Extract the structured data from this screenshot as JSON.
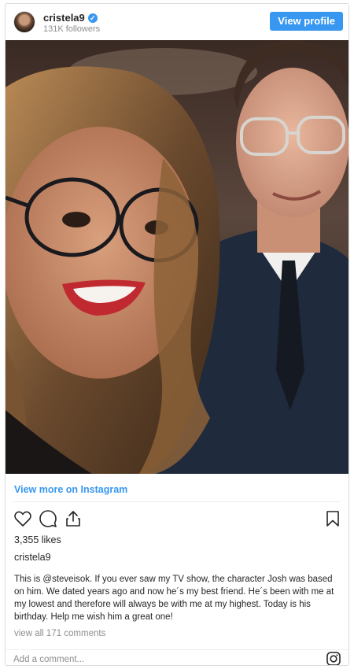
{
  "post": {
    "username": "cristela9",
    "followers": "131K followers",
    "view_profile_label": "View profile",
    "view_more_label": "View more on Instagram",
    "likes": "3,355 likes",
    "caption_username": "cristela9",
    "caption": "This is @steveisok. If you ever saw my TV show, the character Josh was based on him. We dated years ago and now he´s my best friend. He´s been with me at my lowest and therefore will always be with me at my highest. Today is his birthday. Help me wish him a great one!",
    "comments_link": "view all 171 comments",
    "comment_placeholder": "Add a comment..."
  },
  "icons": {
    "verified": "verified-badge-icon",
    "like": "heart-icon",
    "comment": "comment-bubble-icon",
    "share": "share-icon",
    "save": "bookmark-icon",
    "instagram": "instagram-logo-icon"
  },
  "colors": {
    "accent": "#3897f0",
    "text": "#262626",
    "muted": "#8e8e8e",
    "border": "#dbdbdb"
  }
}
